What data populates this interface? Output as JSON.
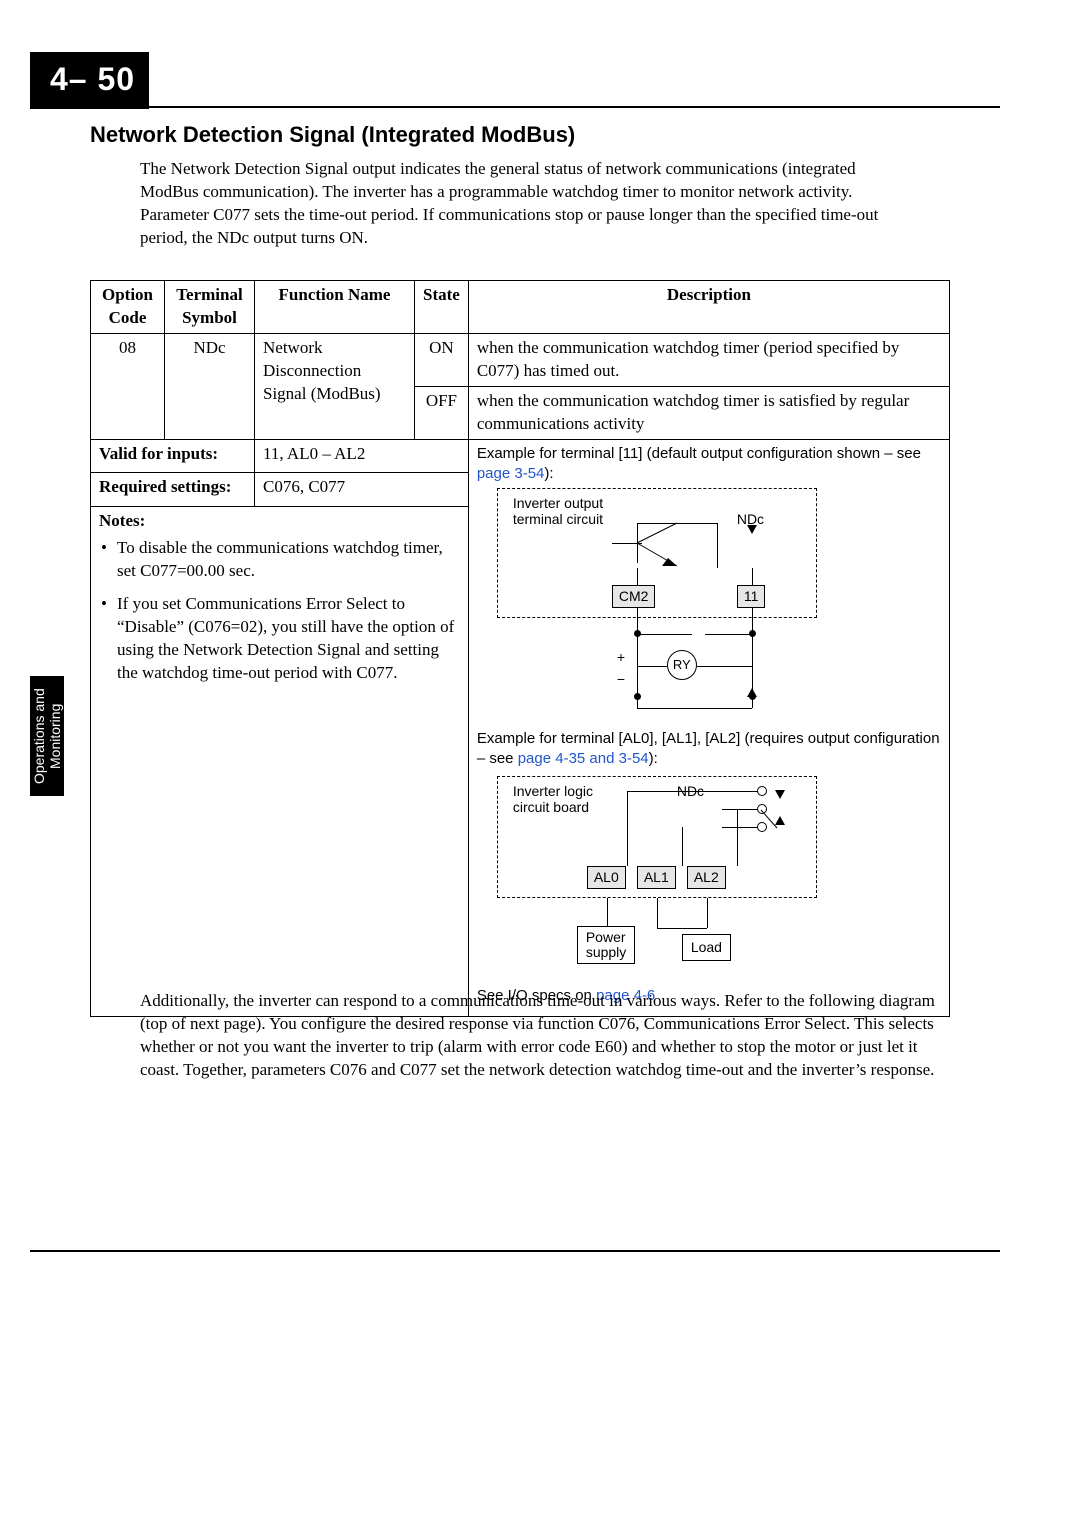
{
  "page_number": "4– 50",
  "side_tab": "Operations and\nMonitoring",
  "heading": "Network Detection Signal (Integrated ModBus)",
  "intro": "The Network Detection Signal output indicates the general status of network communications (integrated ModBus communication). The inverter has a programmable watchdog timer to monitor network activity. Parameter C077 sets the time-out period. If communications stop or pause longer than the specified time-out period, the NDc output turns ON.",
  "table": {
    "headers": {
      "option_code": "Option Code",
      "terminal_symbol": "Terminal Symbol",
      "function_name": "Function Name",
      "state": "State",
      "description": "Description"
    },
    "row": {
      "option_code": "08",
      "terminal_symbol": "NDc",
      "function_name": "Network Disconnection Signal (ModBus)",
      "state_on": "ON",
      "desc_on": "when the communication watchdog timer (period specified by C077) has timed out.",
      "state_off": "OFF",
      "desc_off": "when the communication watchdog timer is satisfied by regular communications activity"
    },
    "valid_for_inputs_label": "Valid for inputs:",
    "valid_for_inputs_value": "11, AL0 – AL2",
    "required_settings_label": "Required settings:",
    "required_settings_value": "C076, C077",
    "notes_label": "Notes:",
    "notes": [
      "To disable the communications watchdog timer, set C077=00.00 sec.",
      "If you set Communications Error Select to “Disable” (C076=02), you still have the option of using the Network Detection Signal and setting the watchdog time-out period with C077."
    ],
    "example1_prefix": "Example for terminal [11] (default output configuration shown – see ",
    "example1_link": "page 3-54",
    "example1_suffix": "):",
    "diag1": {
      "box_label_l1": "Inverter output",
      "box_label_l2": "terminal circuit",
      "ndc": "NDc",
      "cm2": "CM2",
      "t11": "11",
      "ry": "RY",
      "plus": "+",
      "minus": "−"
    },
    "example2_prefix": "Example for terminal [AL0], [AL1], [AL2] (requires output configuration – see ",
    "example2_link": "page 4-35 and 3-54",
    "example2_suffix": "):",
    "diag2": {
      "box_label_l1": "Inverter logic",
      "box_label_l2": "circuit board",
      "ndc": "NDc",
      "al0": "AL0",
      "al1": "AL1",
      "al2": "AL2",
      "power_l1": "Power",
      "power_l2": "supply",
      "load": "Load"
    },
    "iospec_prefix": "See I/O specs on ",
    "iospec_link": "page 4-6"
  },
  "closing": "Additionally, the inverter can respond to a communications time-out in various ways. Refer to the following diagram (top of next page). You configure the desired response via function C076, Communications Error Select. This selects whether or not you want the inverter to trip (alarm with error code E60) and whether to stop the motor or just let it coast. Together, parameters C076 and C077 set the network detection watchdog time-out and the inverter’s response."
}
